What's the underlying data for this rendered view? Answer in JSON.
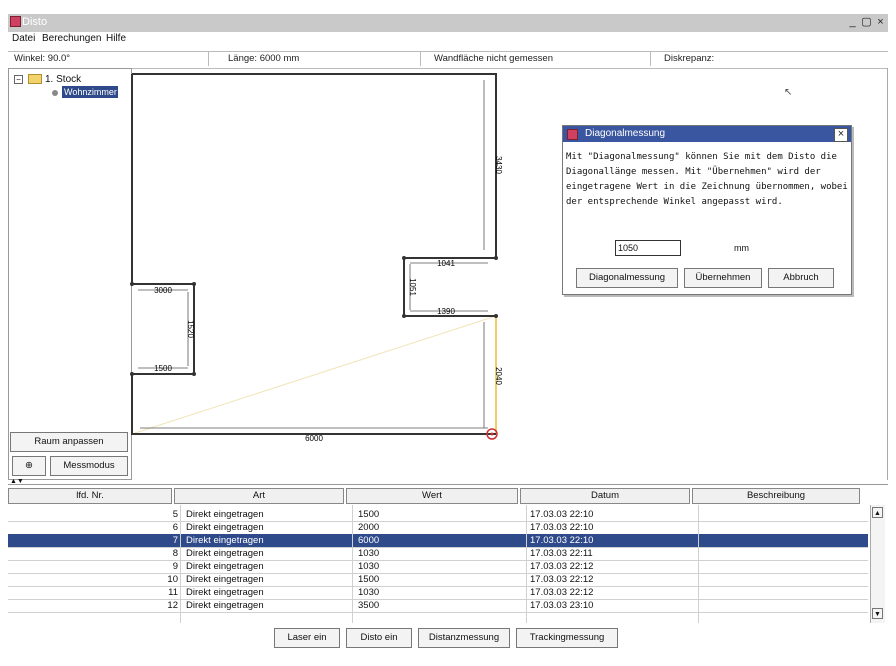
{
  "window": {
    "title": "Disto",
    "controls": {
      "minimize": "_",
      "restore": "▢",
      "close": "×"
    }
  },
  "menu": [
    "Datei",
    "Berechungen",
    "Hilfe"
  ],
  "status": {
    "winkel": "Winkel: 90.0°",
    "laenge": "Länge: 6000 mm",
    "wand": "Wandfläche nicht gemessen",
    "diskrepanz": "Diskrepanz:"
  },
  "tree": {
    "root": "1. Stock",
    "child": "Wohnzimmer"
  },
  "left_buttons": {
    "raum_anpassen": "Raum anpassen",
    "messmodus": "Messmodus"
  },
  "drawing": {
    "dims": {
      "right_top": "3430",
      "notch_top": "1041",
      "notch_side": "1051",
      "notch_bottom": "1390",
      "right_bottom": "2040",
      "left_top": "3000",
      "left_side": "1520",
      "left_bottom": "1500",
      "bottom": "6000"
    }
  },
  "dialog": {
    "title": "Diagonalmessung",
    "text": "Mit \"Diagonalmessung\" können Sie mit dem Disto die Diagonallänge messen. Mit \"Übernehmen\" wird der eingetragene Wert in die Zeichnung übernommen, wobei der entsprechende Winkel angepasst wird.",
    "input_value": "1050",
    "unit": "mm",
    "buttons": {
      "diagonal": "Diagonalmessung",
      "uebernehmen": "Übernehmen",
      "abbruch": "Abbruch"
    },
    "close": "×"
  },
  "table": {
    "headers": [
      "lfd. Nr.",
      "Art",
      "Wert",
      "Datum",
      "Beschreibung"
    ],
    "rows": [
      {
        "nr": "5",
        "art": "Direkt eingetragen",
        "wert": "1500",
        "datum": "17.03.03 22:10",
        "besch": ""
      },
      {
        "nr": "6",
        "art": "Direkt eingetragen",
        "wert": "2000",
        "datum": "17.03.03 22:10",
        "besch": ""
      },
      {
        "nr": "7",
        "art": "Direkt eingetragen",
        "wert": "6000",
        "datum": "17.03.03 22:10",
        "besch": ""
      },
      {
        "nr": "8",
        "art": "Direkt eingetragen",
        "wert": "1030",
        "datum": "17.03.03 22:11",
        "besch": ""
      },
      {
        "nr": "9",
        "art": "Direkt eingetragen",
        "wert": "1030",
        "datum": "17.03.03 22:12",
        "besch": ""
      },
      {
        "nr": "10",
        "art": "Direkt eingetragen",
        "wert": "1500",
        "datum": "17.03.03 22:12",
        "besch": ""
      },
      {
        "nr": "11",
        "art": "Direkt eingetragen",
        "wert": "1030",
        "datum": "17.03.03 22:12",
        "besch": ""
      },
      {
        "nr": "12",
        "art": "Direkt eingetragen",
        "wert": "3500",
        "datum": "17.03.03 23:10",
        "besch": ""
      }
    ],
    "selected_index": 2
  },
  "bottom_buttons": [
    "Laser ein",
    "Disto ein",
    "Distanzmessung",
    "Trackingmessung"
  ],
  "colors": {
    "selection": "#2f4a8a",
    "dialog_title": "#3a56a0",
    "measure_line": "#e8c030",
    "marker": "#d03030"
  }
}
